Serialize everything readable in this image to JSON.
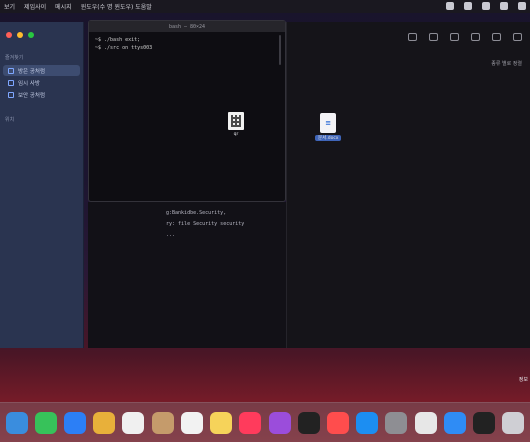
{
  "menubar": {
    "items": [
      "보기",
      "제임사이",
      "메시지",
      "윈도우(수 명 윈도우) 도움말"
    ]
  },
  "sidebar": {
    "section_favorites": "즐겨찾기",
    "items": [
      {
        "label": "방은 공처럼",
        "selected": true
      },
      {
        "label": "임시 사방",
        "selected": false
      },
      {
        "label": "보안 공처럼",
        "selected": false
      }
    ],
    "section_locations": "위치"
  },
  "terminal": {
    "title": "bash — 80×24",
    "lines": [
      "~$ ./bash  exit;",
      "",
      "~$ ./src  on  ttys003",
      "",
      "",
      "",
      "",
      "",
      ""
    ]
  },
  "finder": {
    "sort_label": "종류 별로 정렬"
  },
  "doc_lines": [
    "g:Bankidbe.Security,",
    "ry: file Security security",
    "..."
  ],
  "files": [
    {
      "name": "qr",
      "icon": "qr-code-icon"
    },
    {
      "name": "문서.docx",
      "icon": "document-icon"
    }
  ],
  "dock": {
    "apps": [
      "finder-icon",
      "messages-icon",
      "mail-icon",
      "photos-icon",
      "calendar-icon",
      "contacts-icon",
      "reminders-icon",
      "notes-icon",
      "music-icon",
      "podcasts-icon",
      "tv-icon",
      "news-icon",
      "app-store-icon",
      "settings-icon",
      "chrome-icon",
      "safari-icon",
      "terminal-icon",
      "trash-icon"
    ],
    "colors": [
      "#3a8dde",
      "#37c25a",
      "#2c7ff6",
      "#e8b03a",
      "#f0f0f0",
      "#c59b6b",
      "#f2f2f2",
      "#f6d35a",
      "#ff3b5c",
      "#9b4ddb",
      "#222",
      "#ff4d4d",
      "#1c8ef2",
      "#8e8e93",
      "#e7e7e7",
      "#2f8cf5",
      "#222",
      "#cfcfd4"
    ]
  },
  "side_note": "정보"
}
